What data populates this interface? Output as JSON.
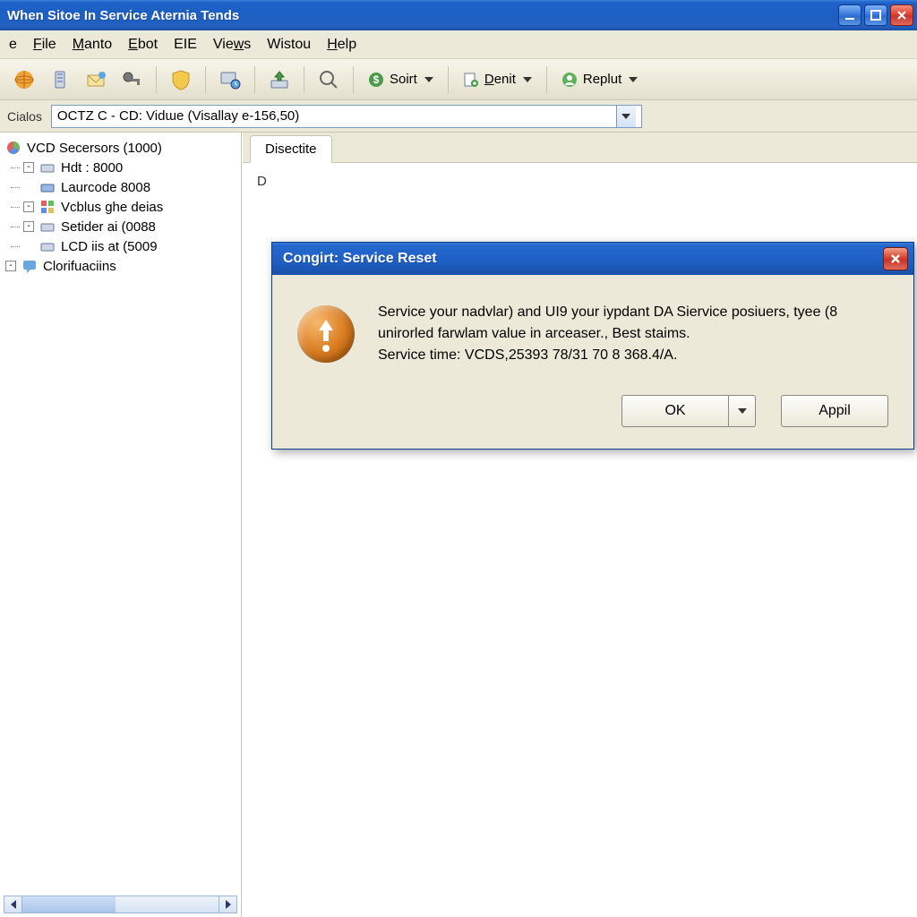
{
  "window": {
    "title": "When Sitoe In Service Aternia Tends"
  },
  "menubar": {
    "items": [
      {
        "label": "e"
      },
      {
        "label": "File",
        "ul": "F"
      },
      {
        "label": "Manto",
        "ul": "M"
      },
      {
        "label": "Ebot",
        "ul": "E"
      },
      {
        "label": "EIE"
      },
      {
        "label": "Views",
        "ul": "V"
      },
      {
        "label": "Wistou"
      },
      {
        "label": "Help",
        "ul": "H"
      }
    ]
  },
  "toolbar": {
    "dropdowns": {
      "soirt": "Soirt",
      "denit": "Denit",
      "replut": "Replut"
    }
  },
  "address": {
    "label": "Cialos",
    "value": "OCTZ C - CD: Vidɯe (Visallay e-156,50)"
  },
  "tree": {
    "root": {
      "label": "VCD Secersors (1000)"
    },
    "children": [
      {
        "label": "Hdt : 8000"
      },
      {
        "label": "Laurcode 8008"
      },
      {
        "label": "Vcblus ghe deias"
      },
      {
        "label": "Setider ai (0088"
      },
      {
        "label": "LCD iis at (5009"
      }
    ],
    "sibling": {
      "label": "Clorifuaciins"
    }
  },
  "tabs": {
    "active": "Disectite"
  },
  "content": {
    "stub": "D"
  },
  "dialog": {
    "title": "Congirt: Service Reset",
    "line1": "Service your nadvlar) and UI9 your iypdant DA Siervice posiuers, tyee (8 unirorled farwlam value in arceaser., Best staims.",
    "line2": "Service time: VCDS,25393 78/31 70 8 368.4/A.",
    "ok_label": "OK",
    "apply_label": "Appil"
  }
}
